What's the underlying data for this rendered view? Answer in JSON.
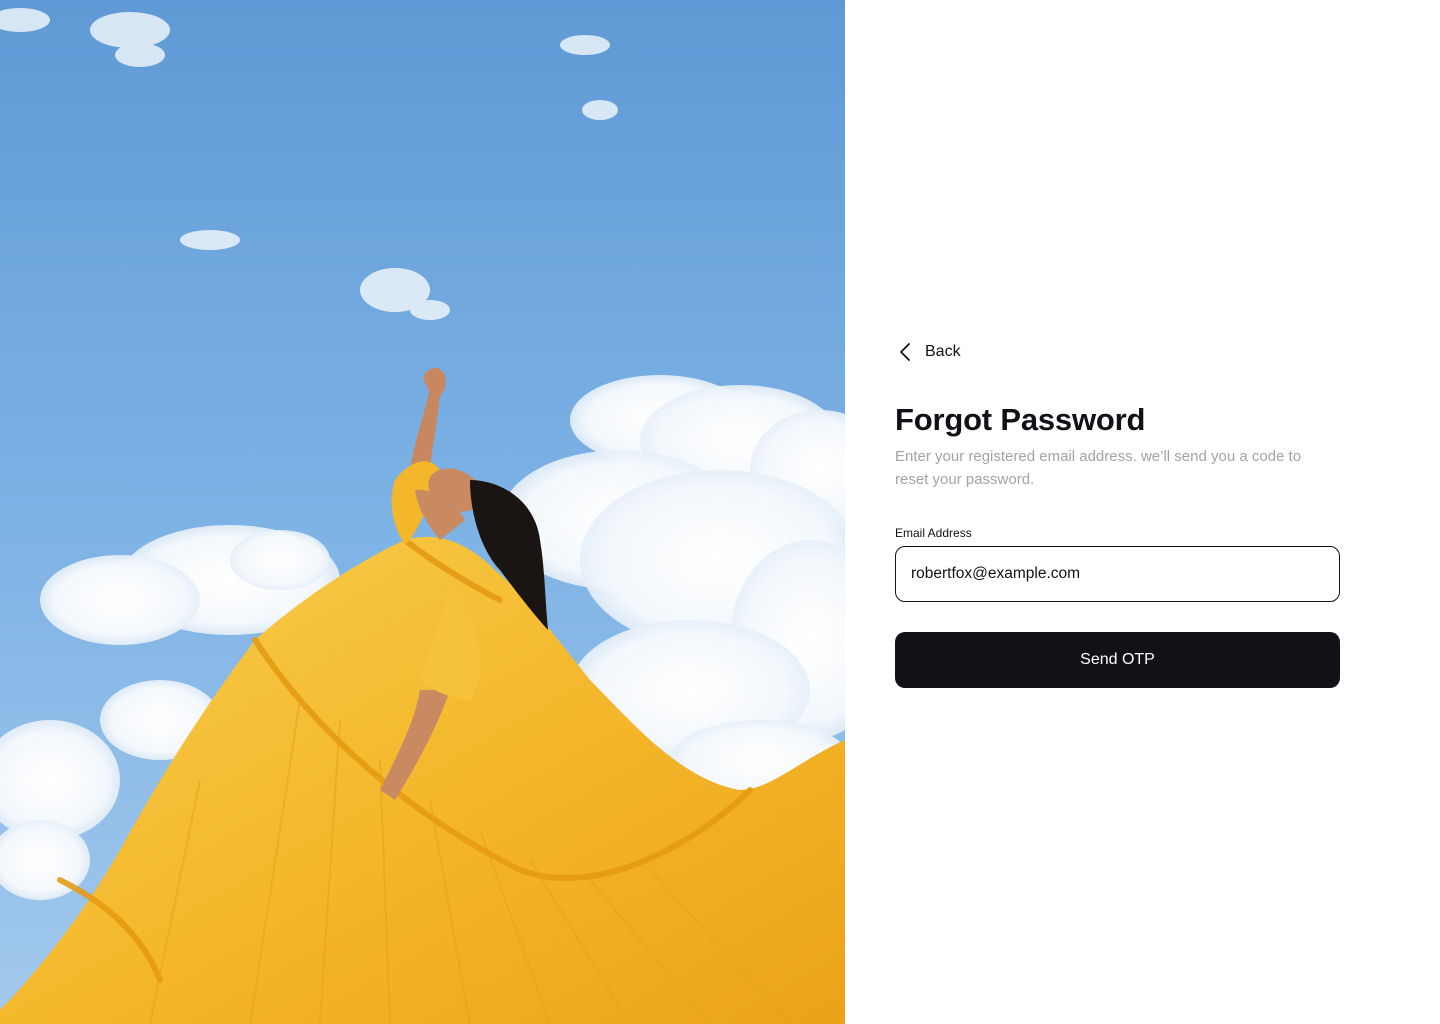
{
  "hero": {
    "image_description": "woman-in-yellow-dress-sky",
    "colors": {
      "sky": "#79b1e4",
      "dress": "#f5b92d",
      "cloud": "#ffffff"
    }
  },
  "back": {
    "label": "Back",
    "icon": "chevron-left-icon"
  },
  "title": "Forgot Password",
  "subtitle": "Enter your registered email address. we’ll send you a code to reset your password.",
  "email": {
    "label": "Email Address",
    "value": "robertfox@example.com",
    "placeholder": ""
  },
  "submit": {
    "label": "Send OTP"
  },
  "colors": {
    "primary": "#131118",
    "muted_text": "#a4a1aa",
    "background": "#ffffff"
  }
}
